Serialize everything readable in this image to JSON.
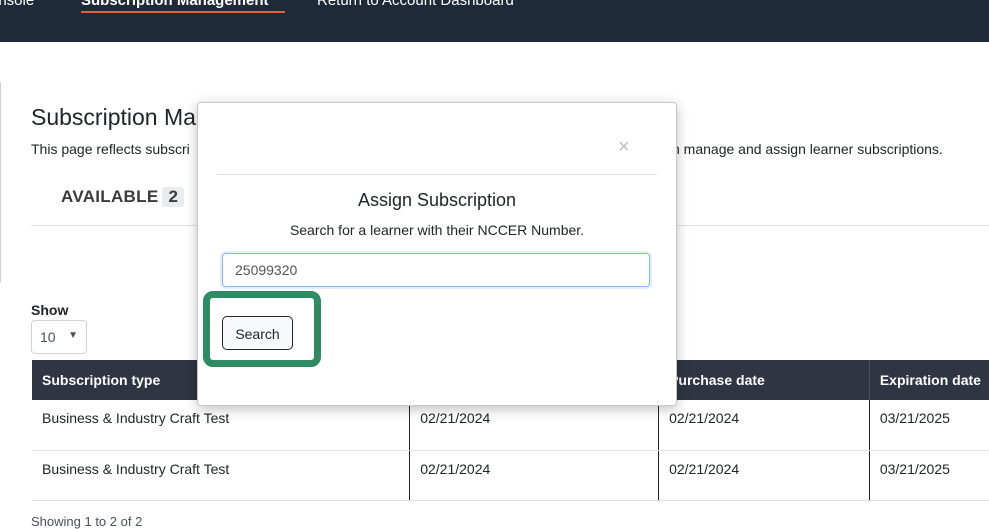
{
  "nav": {
    "items": [
      {
        "label": "onsole"
      },
      {
        "label": "Subscription Management"
      },
      {
        "label": "Return to Account Dashboard"
      }
    ]
  },
  "page": {
    "title": "Subscription Ma",
    "description_left": "This page reflects subscri",
    "description_right": "n manage and assign learner subscriptions.",
    "tab": {
      "label": "AVAILABLE",
      "count": "2"
    },
    "show_label": "Show",
    "show_value": "10",
    "table": {
      "headers": [
        "Subscription type",
        "",
        "Purchase date",
        "Expiration date"
      ],
      "rows": [
        [
          "Business & Industry Craft Test",
          "02/21/2024",
          "02/21/2024",
          "03/21/2025"
        ],
        [
          "Business & Industry Craft Test",
          "02/21/2024",
          "02/21/2024",
          "03/21/2025"
        ]
      ]
    },
    "showing": "Showing 1 to 2 of 2"
  },
  "modal": {
    "close_glyph": "×",
    "title": "Assign Subscription",
    "subtitle": "Search for a learner with their NCCER Number.",
    "input_value": "25099320",
    "search_label": "Search"
  },
  "colors": {
    "nav_bg": "#1e2a38",
    "nav_underline": "#e0603a",
    "table_header_bg": "#2f3542",
    "highlight": "#2e8b62"
  }
}
